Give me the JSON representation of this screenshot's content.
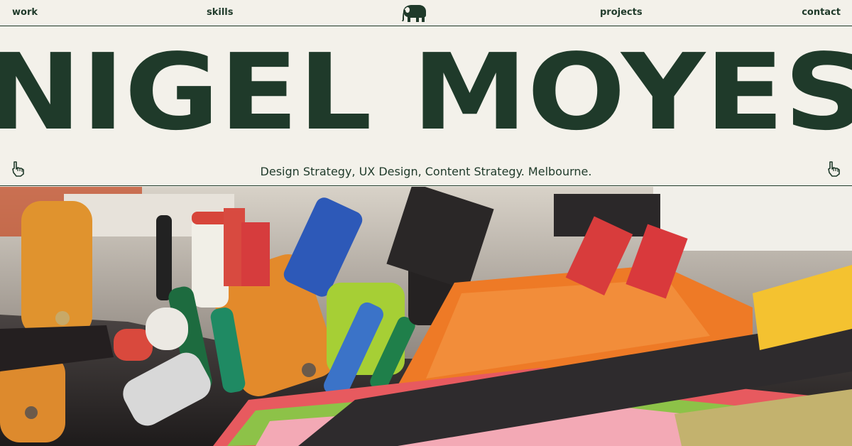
{
  "nav": {
    "work": "work",
    "skills": "skills",
    "projects": "projects",
    "contact": "contact",
    "logo_icon": "elephant-icon"
  },
  "hero": {
    "title": "NIGEL MOYES",
    "tagline": "Design Strategy, UX Design, Content Strategy. Melbourne.",
    "left_icon": "pointing-hand-icon",
    "right_icon": "pointing-hand-icon"
  },
  "colors": {
    "background": "#f3f1ea",
    "accent": "#1f3a2a"
  }
}
